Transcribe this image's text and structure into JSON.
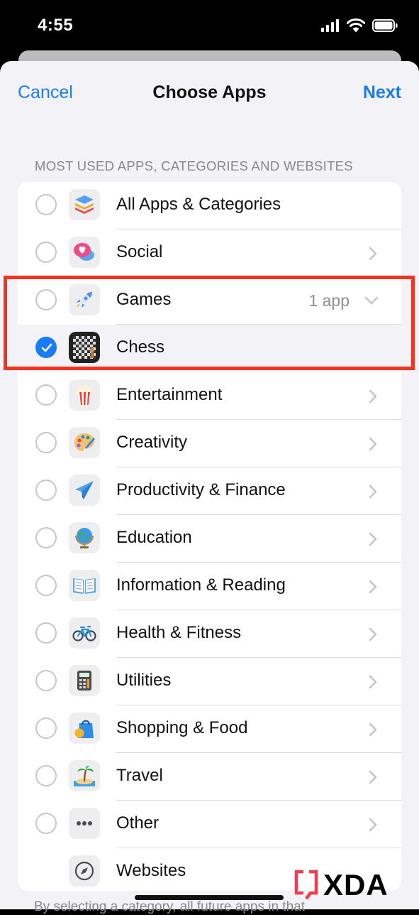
{
  "status_bar": {
    "time": "4:55"
  },
  "nav": {
    "cancel": "Cancel",
    "title": "Choose Apps",
    "next": "Next"
  },
  "section_header": "MOST USED APPS, CATEGORIES AND WEBSITES",
  "rows": [
    {
      "label": "All Apps & Categories",
      "icon": "stack-icon",
      "checked": false,
      "accessory": "none"
    },
    {
      "label": "Social",
      "icon": "heart-bubble-icon",
      "checked": false,
      "accessory": "chevron-right"
    },
    {
      "label": "Games",
      "detail": "1 app",
      "icon": "rocket-icon",
      "checked": false,
      "accessory": "chevron-down"
    },
    {
      "label": "Chess",
      "icon": "chess-board-icon",
      "checked": true,
      "accessory": "none"
    },
    {
      "label": "Entertainment",
      "icon": "popcorn-icon",
      "checked": false,
      "accessory": "chevron-right"
    },
    {
      "label": "Creativity",
      "icon": "palette-icon",
      "checked": false,
      "accessory": "chevron-right"
    },
    {
      "label": "Productivity & Finance",
      "icon": "paper-plane-icon",
      "checked": false,
      "accessory": "chevron-right"
    },
    {
      "label": "Education",
      "icon": "globe-icon",
      "checked": false,
      "accessory": "chevron-right"
    },
    {
      "label": "Information & Reading",
      "icon": "open-book-icon",
      "checked": false,
      "accessory": "chevron-right"
    },
    {
      "label": "Health & Fitness",
      "icon": "bicycle-icon",
      "checked": false,
      "accessory": "chevron-right"
    },
    {
      "label": "Utilities",
      "icon": "calculator-icon",
      "checked": false,
      "accessory": "chevron-right"
    },
    {
      "label": "Shopping & Food",
      "icon": "shopping-bag-icon",
      "checked": false,
      "accessory": "chevron-right"
    },
    {
      "label": "Travel",
      "icon": "palm-island-icon",
      "checked": false,
      "accessory": "chevron-right"
    },
    {
      "label": "Other",
      "icon": "ellipsis-icon",
      "checked": false,
      "accessory": "chevron-right"
    },
    {
      "label": "Websites",
      "icon": "compass-icon",
      "checked": false,
      "accessory": "none"
    }
  ],
  "footer_text": "By selecting a category, all future apps in that",
  "watermark": "XDA",
  "colors": {
    "accent": "#1a7cf5",
    "highlight": "#f2331e"
  }
}
